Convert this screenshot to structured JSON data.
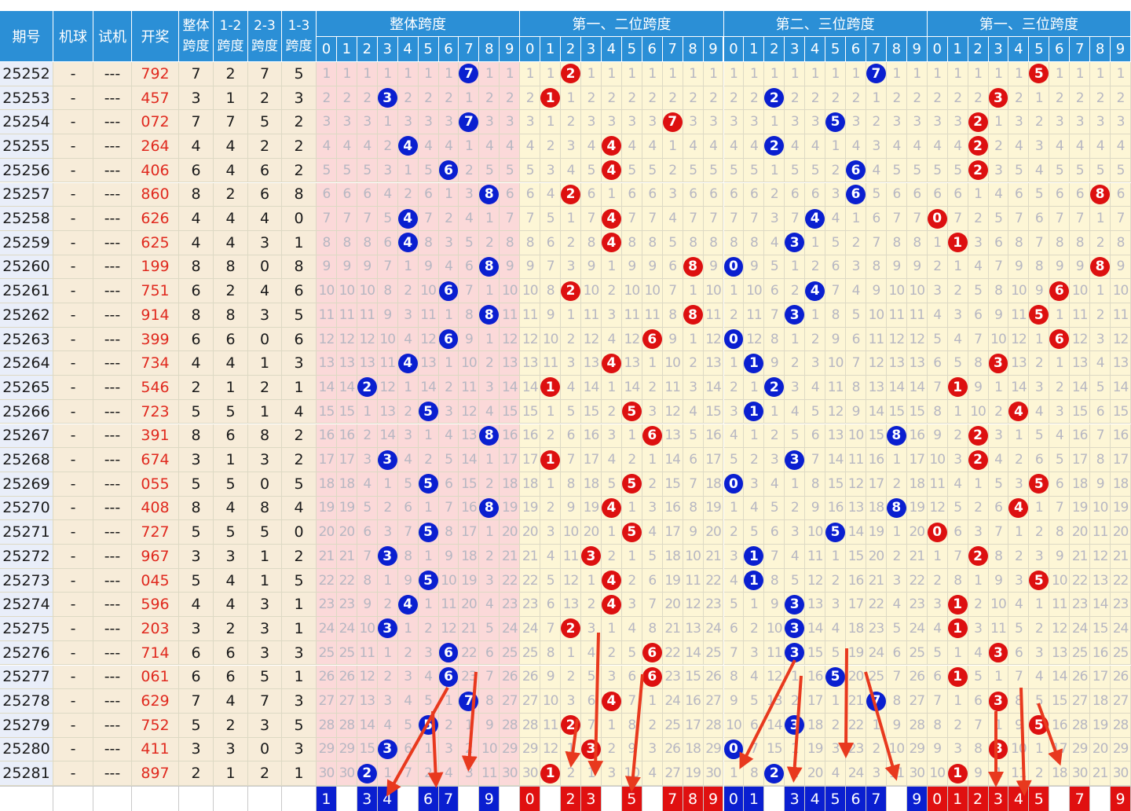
{
  "header": {
    "col_issue": "期号",
    "col_machine": "机球",
    "col_test": "试机",
    "col_draw": "开奖",
    "col_span_all": [
      "整体",
      "跨度"
    ],
    "col_span_12": [
      "1-2",
      "跨度"
    ],
    "col_span_23": [
      "2-3",
      "跨度"
    ],
    "col_span_13": [
      "1-3",
      "跨度"
    ],
    "groups": [
      "整体跨度",
      "第一、二位跨度",
      "第二、三位跨度",
      "第一、三位跨度"
    ],
    "digits": [
      "0",
      "1",
      "2",
      "3",
      "4",
      "5",
      "6",
      "7",
      "8",
      "9"
    ]
  },
  "colors": {
    "header_bg": "#2b8fd6",
    "ball_blue": "#0a1fd0",
    "ball_red": "#dd1010",
    "draw_text": "#e0291e",
    "arrow": "#e8391e"
  },
  "rows": [
    {
      "issue": "25252",
      "machine": "-",
      "test": "---",
      "draw": "792",
      "spans": [
        "7",
        "2",
        "7",
        "5"
      ]
    },
    {
      "issue": "25253",
      "machine": "-",
      "test": "---",
      "draw": "457",
      "spans": [
        "3",
        "1",
        "2",
        "3"
      ]
    },
    {
      "issue": "25254",
      "machine": "-",
      "test": "---",
      "draw": "072",
      "spans": [
        "7",
        "7",
        "5",
        "2"
      ]
    },
    {
      "issue": "25255",
      "machine": "-",
      "test": "---",
      "draw": "264",
      "spans": [
        "4",
        "4",
        "2",
        "2"
      ]
    },
    {
      "issue": "25256",
      "machine": "-",
      "test": "---",
      "draw": "406",
      "spans": [
        "6",
        "4",
        "6",
        "2"
      ]
    },
    {
      "issue": "25257",
      "machine": "-",
      "test": "---",
      "draw": "860",
      "spans": [
        "8",
        "2",
        "6",
        "8"
      ]
    },
    {
      "issue": "25258",
      "machine": "-",
      "test": "---",
      "draw": "626",
      "spans": [
        "4",
        "4",
        "4",
        "0"
      ]
    },
    {
      "issue": "25259",
      "machine": "-",
      "test": "---",
      "draw": "625",
      "spans": [
        "4",
        "4",
        "3",
        "1"
      ]
    },
    {
      "issue": "25260",
      "machine": "-",
      "test": "---",
      "draw": "199",
      "spans": [
        "8",
        "8",
        "0",
        "8"
      ]
    },
    {
      "issue": "25261",
      "machine": "-",
      "test": "---",
      "draw": "751",
      "spans": [
        "6",
        "2",
        "4",
        "6"
      ]
    },
    {
      "issue": "25262",
      "machine": "-",
      "test": "---",
      "draw": "914",
      "spans": [
        "8",
        "8",
        "3",
        "5"
      ]
    },
    {
      "issue": "25263",
      "machine": "-",
      "test": "---",
      "draw": "399",
      "spans": [
        "6",
        "6",
        "0",
        "6"
      ]
    },
    {
      "issue": "25264",
      "machine": "-",
      "test": "---",
      "draw": "734",
      "spans": [
        "4",
        "4",
        "1",
        "3"
      ]
    },
    {
      "issue": "25265",
      "machine": "-",
      "test": "---",
      "draw": "546",
      "spans": [
        "2",
        "1",
        "2",
        "1"
      ]
    },
    {
      "issue": "25266",
      "machine": "-",
      "test": "---",
      "draw": "723",
      "spans": [
        "5",
        "5",
        "1",
        "4"
      ]
    },
    {
      "issue": "25267",
      "machine": "-",
      "test": "---",
      "draw": "391",
      "spans": [
        "8",
        "6",
        "8",
        "2"
      ]
    },
    {
      "issue": "25268",
      "machine": "-",
      "test": "---",
      "draw": "674",
      "spans": [
        "3",
        "1",
        "3",
        "2"
      ]
    },
    {
      "issue": "25269",
      "machine": "-",
      "test": "---",
      "draw": "055",
      "spans": [
        "5",
        "5",
        "0",
        "5"
      ]
    },
    {
      "issue": "25270",
      "machine": "-",
      "test": "---",
      "draw": "408",
      "spans": [
        "8",
        "4",
        "8",
        "4"
      ]
    },
    {
      "issue": "25271",
      "machine": "-",
      "test": "---",
      "draw": "727",
      "spans": [
        "5",
        "5",
        "5",
        "0"
      ]
    },
    {
      "issue": "25272",
      "machine": "-",
      "test": "---",
      "draw": "967",
      "spans": [
        "3",
        "3",
        "1",
        "2"
      ]
    },
    {
      "issue": "25273",
      "machine": "-",
      "test": "---",
      "draw": "045",
      "spans": [
        "5",
        "4",
        "1",
        "5"
      ]
    },
    {
      "issue": "25274",
      "machine": "-",
      "test": "---",
      "draw": "596",
      "spans": [
        "4",
        "4",
        "3",
        "1"
      ]
    },
    {
      "issue": "25275",
      "machine": "-",
      "test": "---",
      "draw": "203",
      "spans": [
        "3",
        "2",
        "3",
        "1"
      ]
    },
    {
      "issue": "25276",
      "machine": "-",
      "test": "---",
      "draw": "714",
      "spans": [
        "6",
        "6",
        "3",
        "3"
      ]
    },
    {
      "issue": "25277",
      "machine": "-",
      "test": "---",
      "draw": "061",
      "spans": [
        "6",
        "6",
        "5",
        "1"
      ]
    },
    {
      "issue": "25278",
      "machine": "-",
      "test": "---",
      "draw": "629",
      "spans": [
        "7",
        "4",
        "7",
        "3"
      ]
    },
    {
      "issue": "25279",
      "machine": "-",
      "test": "---",
      "draw": "752",
      "spans": [
        "5",
        "2",
        "3",
        "5"
      ]
    },
    {
      "issue": "25280",
      "machine": "-",
      "test": "---",
      "draw": "411",
      "spans": [
        "3",
        "3",
        "0",
        "3"
      ]
    },
    {
      "issue": "25281",
      "machine": "-",
      "test": "---",
      "draw": "897",
      "spans": [
        "2",
        "1",
        "2",
        "1"
      ]
    }
  ],
  "forecast": [
    [
      "1",
      "",
      "3",
      "4",
      "",
      "6",
      "7",
      "",
      "9",
      ""
    ],
    [
      "0",
      "",
      "2",
      "3",
      "",
      "5",
      "",
      "7",
      "8",
      "9"
    ],
    [
      "0",
      "1",
      "",
      "3",
      "4",
      "5",
      "6",
      "7",
      "",
      "9"
    ],
    [
      "0",
      "1",
      "2",
      "3",
      "4",
      "5",
      "",
      "7",
      "",
      "9"
    ]
  ]
}
